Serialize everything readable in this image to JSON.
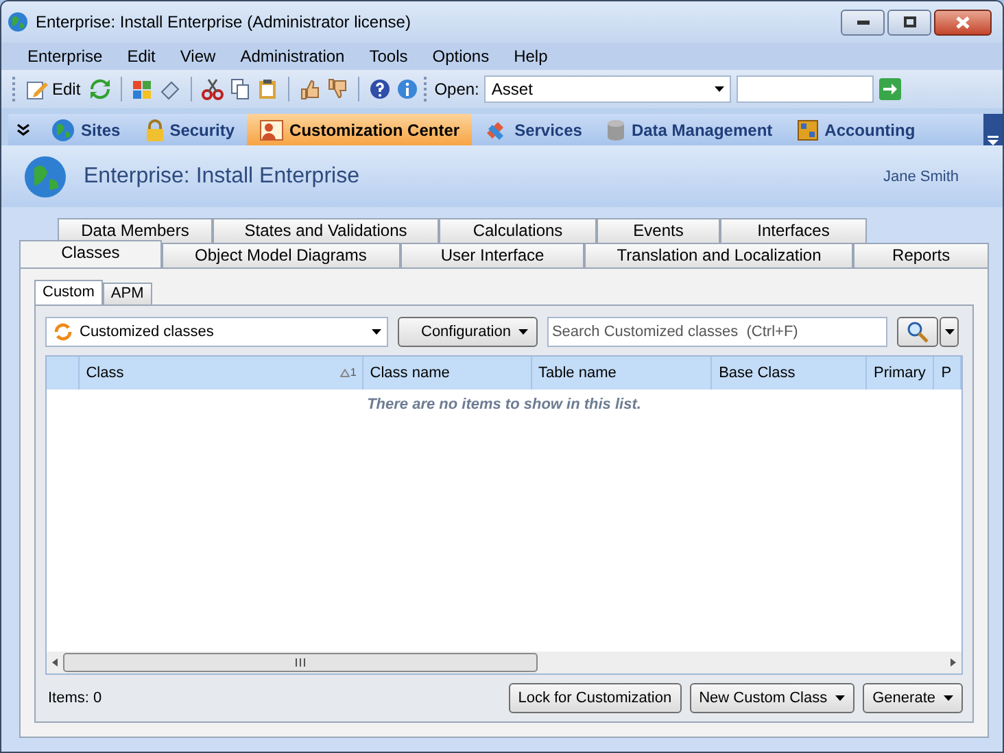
{
  "window": {
    "title": "Enterprise: Install Enterprise (Administrator license)"
  },
  "menu": [
    "Enterprise",
    "Edit",
    "View",
    "Administration",
    "Tools",
    "Options",
    "Help"
  ],
  "toolbar": {
    "edit_label": "Edit",
    "open_label": "Open:",
    "open_value": "Asset"
  },
  "nav": [
    {
      "label": "Sites",
      "selected": false
    },
    {
      "label": "Security",
      "selected": false
    },
    {
      "label": "Customization Center",
      "selected": true
    },
    {
      "label": "Services",
      "selected": false
    },
    {
      "label": "Data Management",
      "selected": false
    },
    {
      "label": "Accounting",
      "selected": false
    }
  ],
  "header": {
    "title": "Enterprise: Install Enterprise",
    "user": "Jane Smith"
  },
  "tab_rows": [
    [
      {
        "label": "Data Members",
        "selected": false
      },
      {
        "label": "States and Validations",
        "selected": false
      },
      {
        "label": "Calculations",
        "selected": false
      },
      {
        "label": "Events",
        "selected": false
      },
      {
        "label": "Interfaces",
        "selected": false
      }
    ],
    [
      {
        "label": "Classes",
        "selected": true
      },
      {
        "label": "Object Model Diagrams",
        "selected": false
      },
      {
        "label": "User Interface",
        "selected": false
      },
      {
        "label": "Translation and Localization",
        "selected": false
      },
      {
        "label": "Reports",
        "selected": false
      }
    ]
  ],
  "subtabs": [
    {
      "label": "Custom",
      "selected": true
    },
    {
      "label": "APM",
      "selected": false
    }
  ],
  "filter": {
    "value": "Customized classes"
  },
  "configuration_button": "Configuration",
  "search": {
    "placeholder": "Search Customized classes  (Ctrl+F)"
  },
  "table": {
    "columns": [
      {
        "label": "Class",
        "sort_order": "1"
      },
      {
        "label": "Class name"
      },
      {
        "label": "Table name"
      },
      {
        "label": "Base Class"
      },
      {
        "label": "Primary"
      },
      {
        "label": "P"
      }
    ],
    "empty_message": "There are no items to show in this list."
  },
  "status": {
    "items": "Items: 0"
  },
  "buttons": [
    {
      "label": "Lock for Customization",
      "kind": "plain"
    },
    {
      "label": "New Custom Class",
      "kind": "dropdown"
    },
    {
      "label": "Generate",
      "kind": "dropdown"
    }
  ]
}
